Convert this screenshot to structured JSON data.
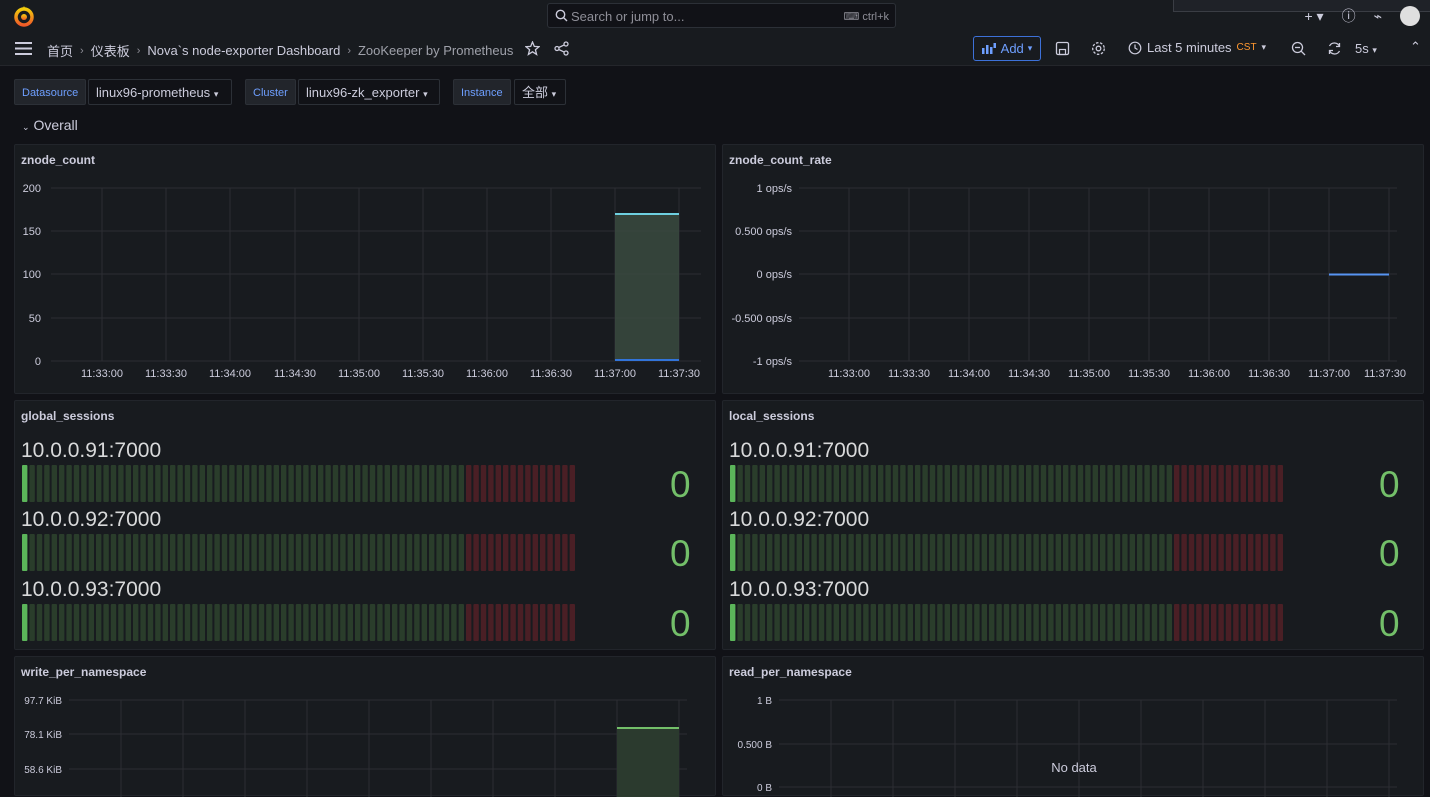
{
  "topbar": {
    "search_placeholder": "Search or jump to...",
    "search_shortcut": "ctrl+k",
    "icons": [
      "grafana-logo-icon",
      "search-icon",
      "keyboard-icon",
      "plus-icon",
      "help-icon",
      "rss-icon",
      "user-avatar-icon"
    ]
  },
  "nav": {
    "breadcrumbs": [
      "首页",
      "仪表板",
      "Nova`s node-exporter Dashboard",
      "ZooKeeper by Prometheus"
    ],
    "add_label": "Add",
    "time_range": "Last 5 minutes",
    "timezone": "CST",
    "refresh": "5s",
    "accent": "#6e9fff"
  },
  "variables": [
    {
      "label": "Datasource",
      "value": "linux96-prometheus"
    },
    {
      "label": "Cluster",
      "value": "linux96-zk_exporter"
    },
    {
      "label": "Instance",
      "value": "全部"
    }
  ],
  "row": {
    "title": "Overall"
  },
  "panels": {
    "znode_count": {
      "title": "znode_count"
    },
    "znode_count_rate": {
      "title": "znode_count_rate"
    },
    "global_sessions": {
      "title": "global_sessions"
    },
    "local_sessions": {
      "title": "local_sessions"
    },
    "write_per_namespace": {
      "title": "write_per_namespace"
    },
    "read_per_namespace": {
      "title": "read_per_namespace",
      "nodata": "No data"
    }
  },
  "gauges": [
    {
      "instance": "10.0.0.91:7000",
      "value": "0"
    },
    {
      "instance": "10.0.0.92:7000",
      "value": "0"
    },
    {
      "instance": "10.0.0.93:7000",
      "value": "0"
    }
  ],
  "chart_data": [
    {
      "type": "area",
      "title": "znode_count",
      "xlabel": "",
      "ylabel": "",
      "x": [
        "11:33:00",
        "11:33:30",
        "11:34:00",
        "11:34:30",
        "11:35:00",
        "11:35:30",
        "11:36:00",
        "11:36:30",
        "11:37:00",
        "11:37:30"
      ],
      "yticks": [
        "200",
        "150",
        "100",
        "50",
        "0"
      ],
      "ylim": [
        0,
        200
      ],
      "series": [
        {
          "values": [
            null,
            null,
            null,
            null,
            null,
            null,
            null,
            null,
            170,
            170
          ],
          "color": "#6ed0e0"
        },
        {
          "values": [
            null,
            null,
            null,
            null,
            null,
            null,
            null,
            null,
            0,
            0
          ],
          "color": "#3274d9"
        }
      ]
    },
    {
      "type": "line",
      "title": "znode_count_rate",
      "xlabel": "",
      "ylabel": "",
      "x": [
        "11:33:00",
        "11:33:30",
        "11:34:00",
        "11:34:30",
        "11:35:00",
        "11:35:30",
        "11:36:00",
        "11:36:30",
        "11:37:00",
        "11:37:30"
      ],
      "yticks": [
        "1 ops/s",
        "0.500 ops/s",
        "0 ops/s",
        "-0.500 ops/s",
        "-1 ops/s"
      ],
      "ylim": [
        -1,
        1
      ],
      "series": [
        {
          "values": [
            null,
            null,
            null,
            null,
            null,
            null,
            null,
            null,
            0,
            0
          ],
          "color": "#5794f2"
        }
      ]
    },
    {
      "type": "area",
      "title": "write_per_namespace",
      "xlabel": "",
      "ylabel": "",
      "yticks": [
        "97.7 KiB",
        "78.1 KiB",
        "58.6 KiB"
      ],
      "series": [
        {
          "values": [
            80000
          ],
          "color": "#73bf69"
        }
      ]
    },
    {
      "type": "line",
      "title": "read_per_namespace",
      "xlabel": "",
      "ylabel": "",
      "yticks": [
        "1 B",
        "0.500 B",
        "0 B"
      ],
      "series": []
    }
  ]
}
